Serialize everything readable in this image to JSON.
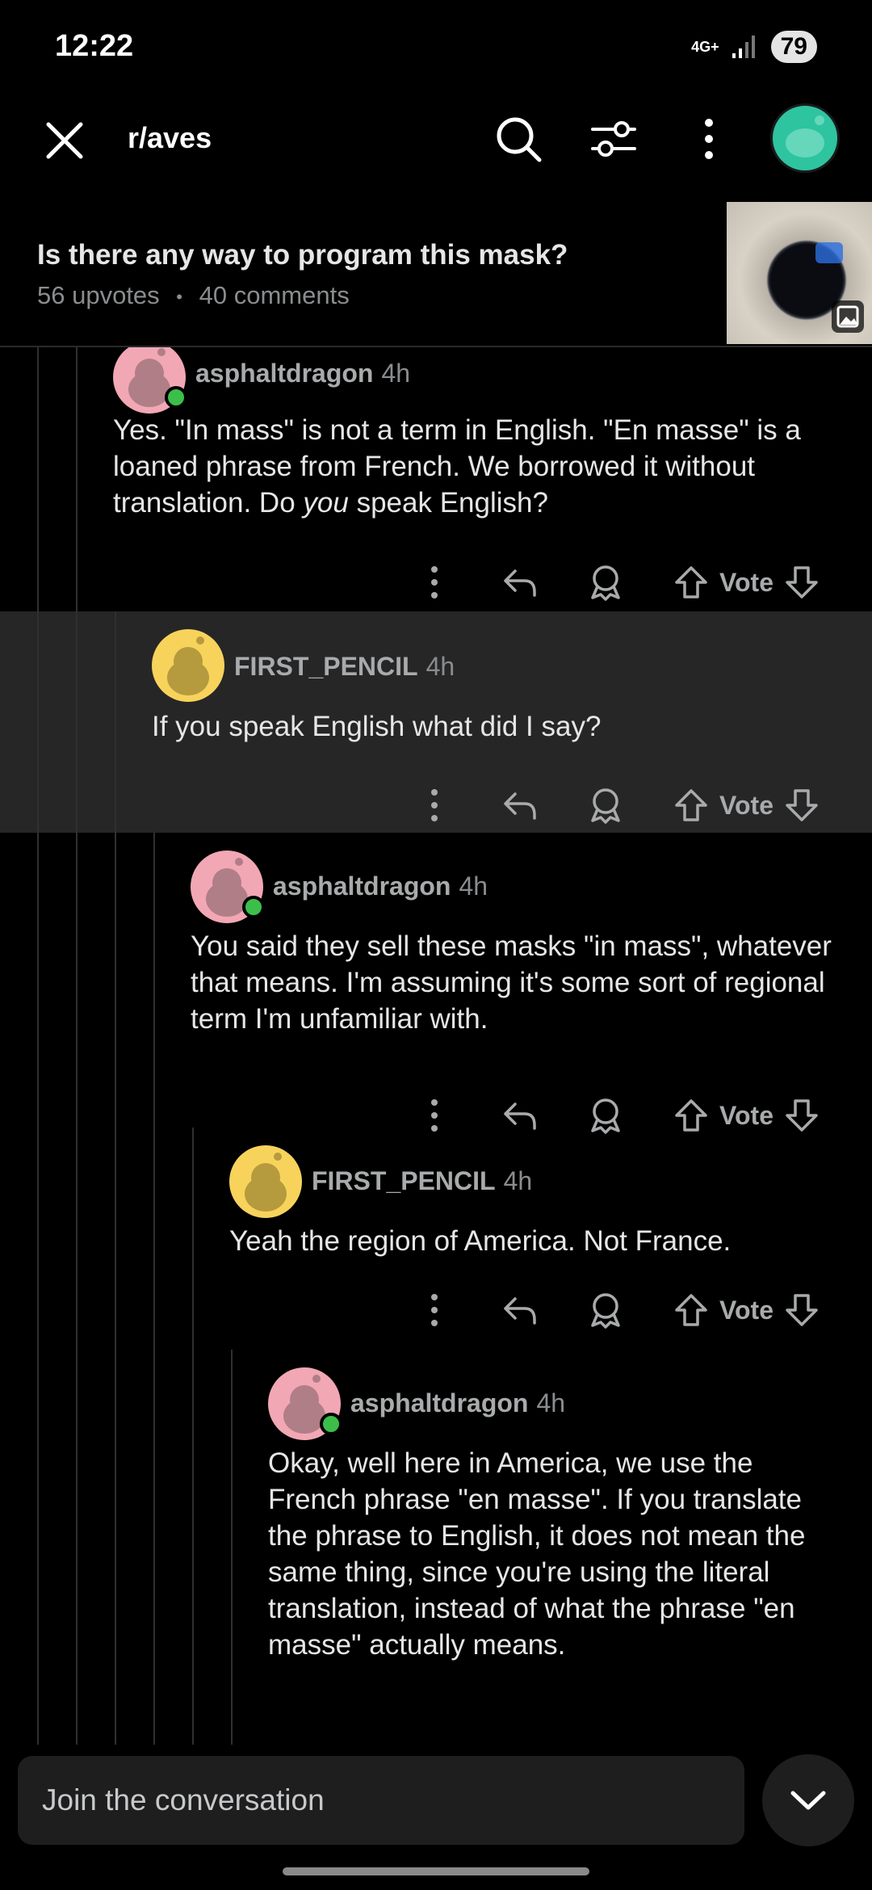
{
  "status_bar": {
    "time": "12:22",
    "network": "4G+",
    "battery": "79"
  },
  "header": {
    "subreddit": "r/aves",
    "post_title": "Is there any way to program this mask?",
    "upvotes": "56 upvotes",
    "separator": "•",
    "comments": "40 comments"
  },
  "comments": [
    {
      "username": "asphaltdragon",
      "time": "4h",
      "body_parts": [
        "Yes. \"In mass\" is not a term in English. \"En masse\" is a loaned phrase from French. We borrowed it without translation. Do ",
        "you",
        " speak English?"
      ],
      "vote_label": "Vote"
    },
    {
      "username": "FIRST_PENCIL",
      "time": "4h",
      "body": "If you speak English what did I say?",
      "vote_label": "Vote"
    },
    {
      "username": "asphaltdragon",
      "time": "4h",
      "body": "You said they sell these masks \"in mass\", whatever that means. I'm assuming it's some sort of regional term I'm unfamiliar with.",
      "vote_label": "Vote"
    },
    {
      "username": "FIRST_PENCIL",
      "time": "4h",
      "body": "Yeah the region of America. Not France.",
      "vote_label": "Vote"
    },
    {
      "username": "asphaltdragon",
      "time": "4h",
      "body": "Okay, well here in America, we use the French phrase \"en masse\". If you translate the phrase to English, it does not mean the same thing, since you're using the literal translation, instead of what the phrase \"en masse\" actually means."
    }
  ],
  "composer": {
    "placeholder": "Join the conversation"
  },
  "colors": {
    "online": "#3bbf4a",
    "avatar_pink": "#f2a7b4",
    "avatar_yellow": "#f7d35c",
    "user_avatar": "#2ec4a0"
  },
  "icons": [
    "close-icon",
    "search-icon",
    "filter-icon",
    "more-vertical-icon",
    "reply-icon",
    "award-icon",
    "upvote-icon",
    "downvote-icon",
    "chevron-down-icon"
  ]
}
